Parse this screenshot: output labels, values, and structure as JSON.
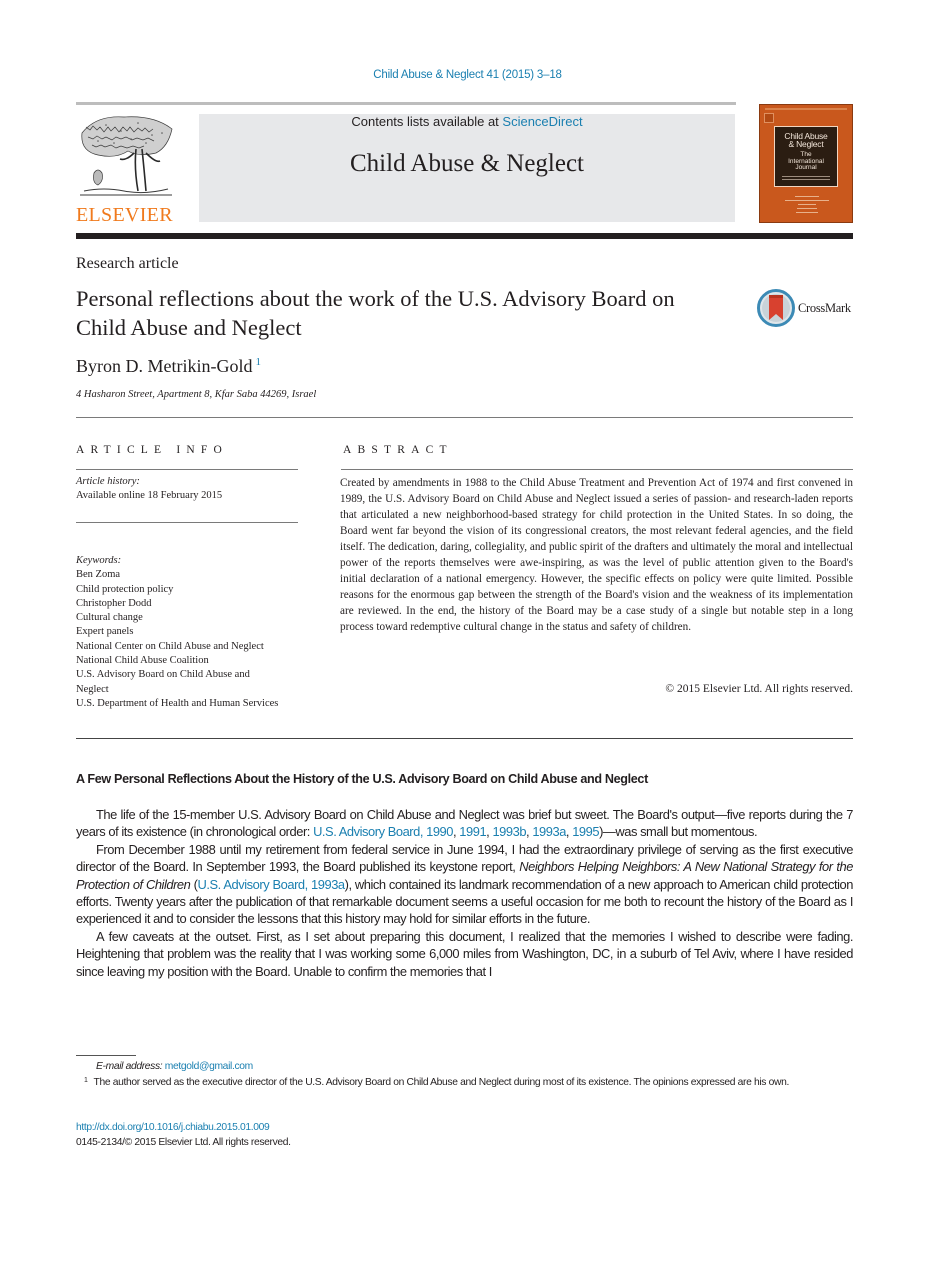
{
  "header": {
    "citation": "Child Abuse & Neglect 41 (2015) 3–18",
    "contents_prefix": "Contents lists available at ",
    "contents_link": "ScienceDirect",
    "journal_name": "Child Abuse & Neglect",
    "publisher": "ELSEVIER",
    "cover": {
      "title_line1": "Child Abuse",
      "title_line2": "& Neglect",
      "subtitle_line1": "The",
      "subtitle_line2": "International",
      "subtitle_line3": "Journal"
    },
    "colors": {
      "link": "#1a7fb0",
      "elsevier_orange": "#f07a1d",
      "cover_orange": "#c9581d",
      "journal_box_bg": "#e7e8ea"
    }
  },
  "article": {
    "type": "Research article",
    "title": "Personal reflections about the work of the U.S. Advisory Board on Child Abuse and Neglect",
    "crossmark_label": "CrossMark",
    "author": "Byron D. Metrikin-Gold",
    "author_footnote": "1",
    "affiliation": "4 Hasharon Street, Apartment 8, Kfar Saba 44269, Israel"
  },
  "article_info": {
    "heading": "ARTICLE INFO",
    "history_label": "Article history:",
    "history_value": "Available online 18 February 2015",
    "keywords_label": "Keywords:",
    "keywords": [
      "Ben Zoma",
      "Child protection policy",
      "Christopher Dodd",
      "Cultural change",
      "Expert panels",
      "National Center on Child Abuse and Neglect",
      "National Child Abuse Coalition",
      "U.S. Advisory Board on Child Abuse and Neglect",
      "U.S. Department of Health and Human Services"
    ]
  },
  "abstract": {
    "heading": "ABSTRACT",
    "text": "Created by amendments in 1988 to the Child Abuse Treatment and Prevention Act of 1974 and first convened in 1989, the U.S. Advisory Board on Child Abuse and Neglect issued a series of passion- and research-laden reports that articulated a new neighborhood-based strategy for child protection in the United States. In so doing, the Board went far beyond the vision of its congressional creators, the most relevant federal agencies, and the field itself. The dedication, daring, collegiality, and public spirit of the drafters and ultimately the moral and intellectual power of the reports themselves were awe-inspiring, as was the level of public attention given to the Board's initial declaration of a national emergency. However, the specific effects on policy were quite limited. Possible reasons for the enormous gap between the strength of the Board's vision and the weakness of its implementation are reviewed. In the end, the history of the Board may be a case study of a single but notable step in a long process toward redemptive cultural change in the status and safety of children.",
    "copyright": "© 2015 Elsevier Ltd. All rights reserved."
  },
  "body": {
    "section_heading": "A Few Personal Reflections About the History of the U.S. Advisory Board on Child Abuse and Neglect",
    "p1": {
      "before": "The life of the 15-member U.S. Advisory Board on Child Abuse and Neglect was brief but sweet. The Board's output—five reports during the 7 years of its existence (in chronological order: ",
      "refs": [
        "U.S. Advisory Board, 1990",
        "1991",
        "1993b",
        "1993a",
        "1995"
      ],
      "after": ")—was small but momentous."
    },
    "p2": {
      "before": "From December 1988 until my retirement from federal service in June 1994, I had the extraordinary privilege of serving as the first executive director of the Board. In September 1993, the Board published its keystone report, ",
      "italic": "Neighbors Helping Neighbors: A New National Strategy for the Protection of Children",
      "mid": " (",
      "ref": "U.S. Advisory Board, 1993a",
      "after": "), which contained its landmark recommendation of a new approach to American child protection efforts. Twenty years after the publication of that remarkable document seems a useful occasion for me both to recount the history of the Board as I experienced it and to consider the lessons that this history may hold for similar efforts in the future."
    },
    "p3": "A few caveats at the outset. First, as I set about preparing this document, I realized that the memories I wished to describe were fading. Heightening that problem was the reality that I was working some 6,000 miles from Washington, DC, in a suburb of Tel Aviv, where I have resided since leaving my position with the Board. Unable to confirm the memories that I"
  },
  "footnotes": {
    "email_label": "E-mail address:",
    "email": "metgold@gmail.com",
    "fn1_marker": "1",
    "fn1_text": "The author served as the executive director of the U.S. Advisory Board on Child Abuse and Neglect during most of its existence. The opinions expressed are his own.",
    "doi": "http://dx.doi.org/10.1016/j.chiabu.2015.01.009",
    "issn_copyright": "0145-2134/© 2015 Elsevier Ltd. All rights reserved."
  }
}
